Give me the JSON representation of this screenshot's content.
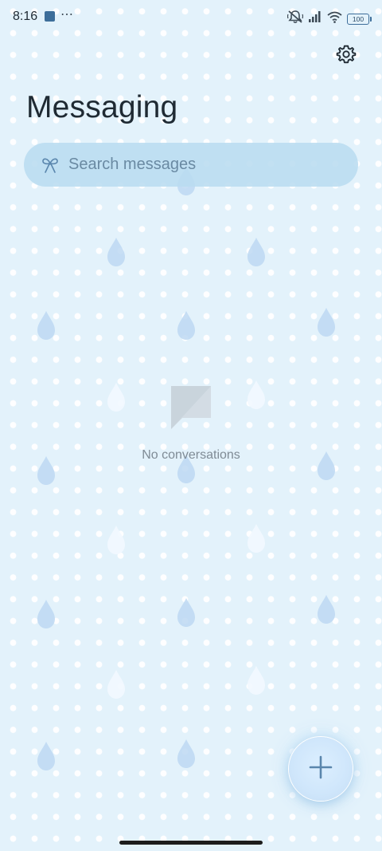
{
  "status_bar": {
    "time": "8:16",
    "more": "⋯",
    "battery": "100"
  },
  "header": {
    "title": "Messaging",
    "settings_icon": "gear-icon"
  },
  "search": {
    "placeholder": "Search messages",
    "value": "",
    "icon": "ribbon-icon"
  },
  "empty_state": {
    "icon": "message-bubble-icon",
    "text": "No conversations"
  },
  "fab": {
    "icon": "plus-icon"
  },
  "colors": {
    "background": "#e3f2fb",
    "accent": "#3d6e9a",
    "search_bg": "#badcf0",
    "raindrop": "#bcd8f1"
  }
}
